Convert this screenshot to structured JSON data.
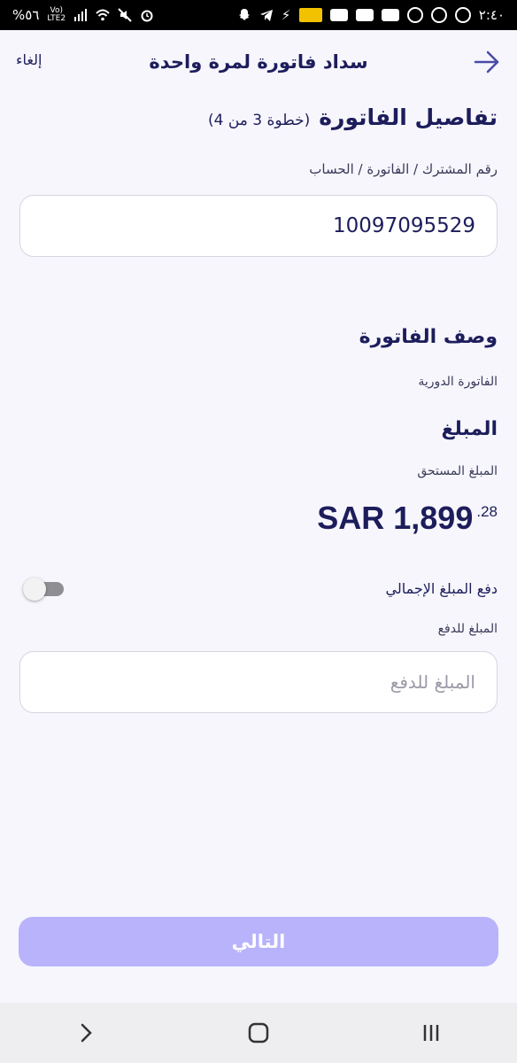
{
  "status_bar": {
    "time": "٢:٤٠",
    "battery": "%٥٦",
    "network": "LTE2"
  },
  "header": {
    "title": "سداد فاتورة لمرة واحدة",
    "cancel_label": "إلغاء",
    "back_icon": "arrow-right-icon"
  },
  "bill_details": {
    "title": "تفاصيل الفاتورة",
    "step": "(خطوة 3 من 4)",
    "account_label": "رقم المشترك / الفاتورة / الحساب",
    "account_value": "10097095529"
  },
  "bill_description": {
    "title": "وصف الفاتورة",
    "value": "الفاتورة الدورية"
  },
  "amount_section": {
    "title": "المبلغ",
    "due_label": "المبلغ المستحق",
    "currency": "SAR",
    "integer_part": "1,899",
    "decimal_part": ".28"
  },
  "pay_full": {
    "label": "دفع المبلغ الإجمالي",
    "enabled": false
  },
  "pay_amount": {
    "label": "المبلغ للدفع",
    "placeholder": "المبلغ للدفع"
  },
  "next_button": {
    "label": "التالي"
  },
  "colors": {
    "primary_text": "#1d1d5c",
    "button_disabled": "#b8b3fb",
    "background": "#f6f6fc"
  }
}
